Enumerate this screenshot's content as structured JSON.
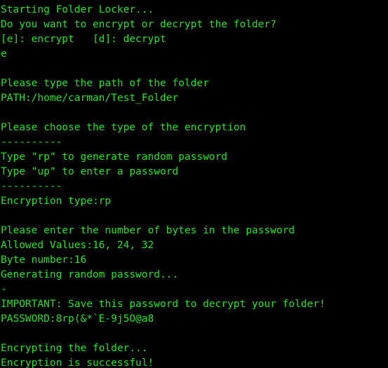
{
  "terminal": {
    "title": "Folder Locker",
    "foreground_color": "#1ee61e",
    "background_color": "#000000",
    "lines": [
      {
        "id": "startup-banner",
        "text": "Starting Folder Locker..."
      },
      {
        "id": "prompt-mode-question",
        "text": "Do you want to encrypt or decrypt the folder?"
      },
      {
        "id": "prompt-mode-options",
        "text": "[e]: encrypt   [d]: decrypt"
      },
      {
        "id": "input-mode-answer",
        "text": "e"
      },
      {
        "id": "spacer-1",
        "text": ""
      },
      {
        "id": "prompt-path-question",
        "text": "Please type the path of the folder"
      },
      {
        "id": "input-path-answer",
        "text": "PATH:/home/carman/Test_Folder"
      },
      {
        "id": "spacer-2",
        "text": ""
      },
      {
        "id": "prompt-enctype-header",
        "text": "Please choose the type of the encryption"
      },
      {
        "id": "divider-top",
        "text": "----------"
      },
      {
        "id": "option-random-password",
        "text": "Type \"rp\" to generate random password"
      },
      {
        "id": "option-user-password",
        "text": "Type \"up\" to enter a password"
      },
      {
        "id": "divider-bottom",
        "text": "----------"
      },
      {
        "id": "input-enctype-answer",
        "text": "Encryption type:rp"
      },
      {
        "id": "spacer-3",
        "text": ""
      },
      {
        "id": "prompt-bytes-question",
        "text": "Please enter the number of bytes in the password"
      },
      {
        "id": "info-allowed-values",
        "text": "Allowed Values:16, 24, 32"
      },
      {
        "id": "input-bytes-answer",
        "text": "Byte number:16"
      },
      {
        "id": "status-generating",
        "text": "Generating random password..."
      },
      {
        "id": "spinner-frame",
        "text": "-"
      },
      {
        "id": "warning-save-password",
        "text": "IMPORTANT: Save this password to decrypt your folder!"
      },
      {
        "id": "output-password",
        "text": "PASSWORD:8rp(&*`E-9j5O@a8"
      },
      {
        "id": "spacer-4",
        "text": ""
      },
      {
        "id": "status-encrypting",
        "text": "Encrypting the folder..."
      },
      {
        "id": "status-success",
        "text": "Encryption is successful!"
      }
    ]
  }
}
